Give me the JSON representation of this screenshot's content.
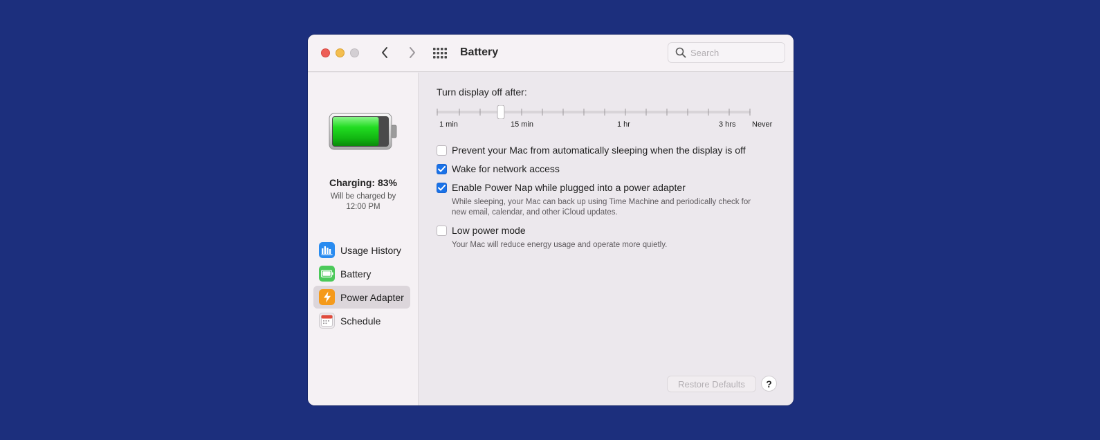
{
  "window": {
    "title": "Battery",
    "search": {
      "placeholder": "Search",
      "value": ""
    }
  },
  "sidebar": {
    "battery_level": 0.83,
    "charging_title": "Charging: 83%",
    "charging_sub_line1": "Will be charged by",
    "charging_sub_line2": "12:00 PM",
    "items": [
      {
        "label": "Usage History",
        "icon": "bar-chart-icon",
        "color": "#2a8cf0",
        "selected": false
      },
      {
        "label": "Battery",
        "icon": "battery-icon",
        "color": "#4cc95a",
        "selected": false
      },
      {
        "label": "Power Adapter",
        "icon": "lightning-bolt-icon",
        "color": "#f59a1b",
        "selected": true
      },
      {
        "label": "Schedule",
        "icon": "calendar-icon",
        "color": "#e24a3b",
        "selected": false
      }
    ]
  },
  "main": {
    "slider": {
      "label": "Turn display off after:",
      "value": "15 min",
      "tick_labels": [
        "1 min",
        "15 min",
        "1 hr",
        "3 hrs",
        "Never"
      ]
    },
    "options": [
      {
        "label": "Prevent your Mac from automatically sleeping when the display is off",
        "checked": false,
        "description": ""
      },
      {
        "label": "Wake for network access",
        "checked": true,
        "description": ""
      },
      {
        "label": "Enable Power Nap while plugged into a power adapter",
        "checked": true,
        "description_line1": "While sleeping, your Mac can back up using Time Machine and periodically check for",
        "description_line2": "new email, calendar, and other iCloud updates."
      },
      {
        "label": "Low power mode",
        "checked": false,
        "description_line1": "Your Mac will reduce energy usage and operate more quietly."
      }
    ],
    "restore_defaults": "Restore Defaults",
    "help": "?"
  },
  "colors": {
    "background": "#1c2f7d",
    "accent": "#1a72e8",
    "battery_green": "#1fd11f"
  }
}
